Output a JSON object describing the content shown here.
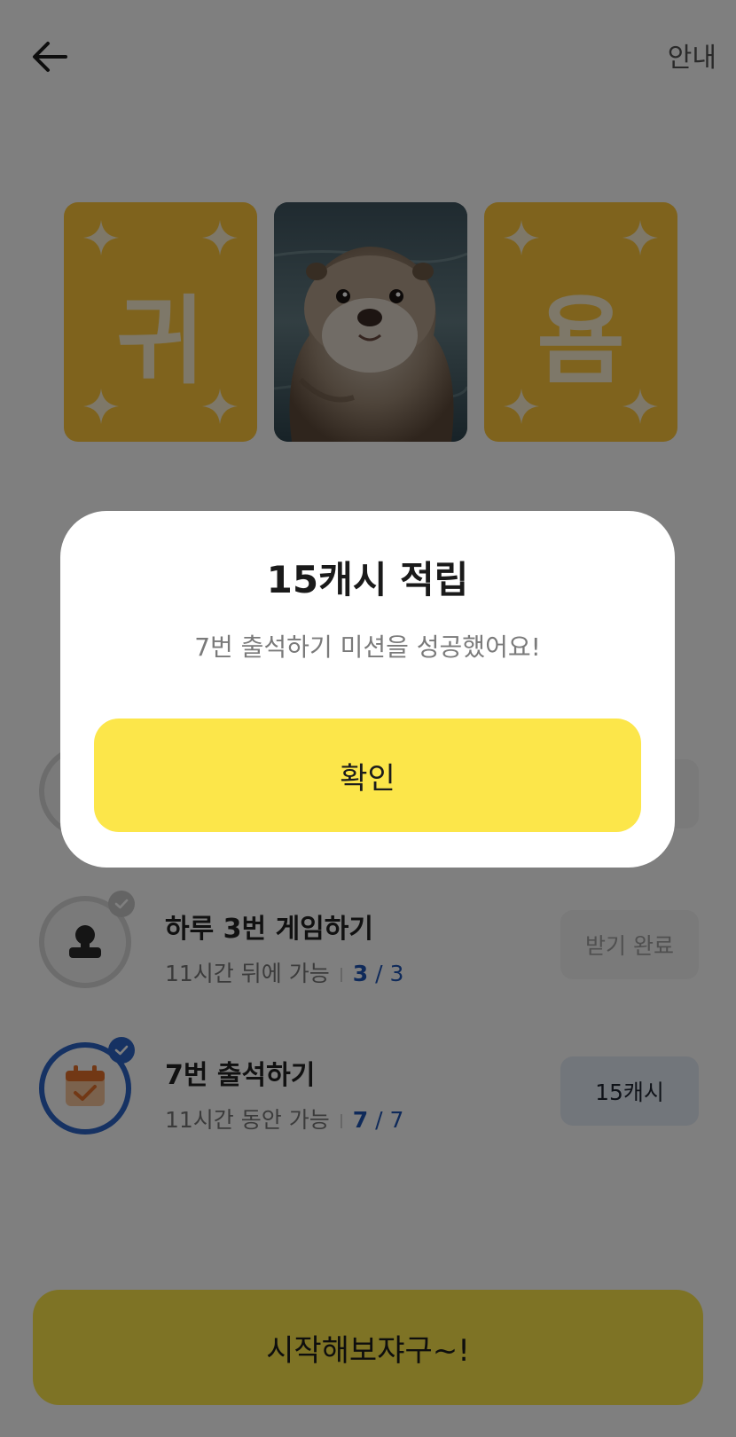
{
  "header": {
    "back_icon": "arrow-left-icon",
    "guide_label": "안내"
  },
  "cards": [
    {
      "letter": "귀",
      "type": "letter"
    },
    {
      "letter": "",
      "type": "photo",
      "subject": "otter"
    },
    {
      "letter": "욤",
      "type": "letter"
    }
  ],
  "missions": [
    {
      "title": "하루 3번 게임하기",
      "subtitle": "11시간 뒤에 가능",
      "progress_current": "3",
      "progress_total": "3",
      "button_label": "받기 완료",
      "icon": "stamp-icon",
      "completed": true
    },
    {
      "title": "7번 출석하기",
      "subtitle": "11시간 동안 가능",
      "progress_current": "7",
      "progress_total": "7",
      "button_label": "15캐시",
      "icon": "calendar-check-icon",
      "completed": true
    }
  ],
  "start_button_label": "시작해보쟈구~!",
  "modal": {
    "title": "15캐시 적립",
    "message": "7번 출석하기 미션을 성공했어요!",
    "confirm_label": "확인"
  },
  "colors": {
    "accent_yellow": "#fce64a",
    "card_gold": "#ffc73a",
    "progress_blue": "#1f55b5",
    "overlay": "rgba(0,0,0,0.5)"
  }
}
